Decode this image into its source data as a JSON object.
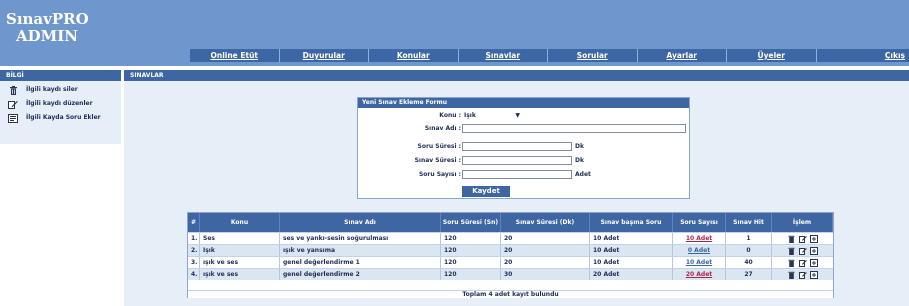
{
  "app": {
    "title_line1": "SınavPRO",
    "title_line2": "ADMIN"
  },
  "nav": [
    {
      "label": "Online Etüt"
    },
    {
      "label": "Duyurular"
    },
    {
      "label": "Konular"
    },
    {
      "label": "Sınavlar"
    },
    {
      "label": "Sorular"
    },
    {
      "label": "Ayarlar"
    },
    {
      "label": "Üyeler"
    },
    {
      "label": "Çıkış"
    }
  ],
  "sidebar": {
    "title": "BİLGİ",
    "items": [
      {
        "label": "İlgili kaydı siler",
        "icon": "trash-icon"
      },
      {
        "label": "İlgili kaydı düzenler",
        "icon": "edit-icon"
      },
      {
        "label": "İlgili Kayda Soru Ekler",
        "icon": "add-question-icon"
      }
    ]
  },
  "main": {
    "title": "SINAVLAR"
  },
  "form": {
    "title": "Yeni Sınav Ekleme Formu",
    "konu_label": "Konu :",
    "konu_value": "Işık",
    "sinav_adi_label": "Sınav Adı :",
    "sinav_adi_value": "",
    "soru_suresi_label": "Soru Süresi :",
    "soru_suresi_unit": "Dk",
    "sinav_suresi_label": "Sınav Süresi :",
    "sinav_suresi_unit": "Dk",
    "soru_sayisi_label": "Soru Sayısı :",
    "soru_sayisi_unit": "Adet",
    "submit_label": "Kaydet"
  },
  "table": {
    "headers": [
      "#",
      "Konu",
      "Sınav Adı",
      "Soru Süresi (Sn)",
      "Sınav Süresi (Dk)",
      "Sınav başına Soru",
      "Soru Sayısı",
      "Sınav Hit",
      "İşlem"
    ],
    "rows": [
      {
        "no": "1.",
        "konu": "Ses",
        "sinav_adi": "ses ve yankı-sesin soğurulması",
        "soru_suresi": "120",
        "sinav_suresi": "20",
        "soru_basina": "10 Adet",
        "soru_sayisi": "10 Adet",
        "hit": "1"
      },
      {
        "no": "2.",
        "konu": "Işık",
        "sinav_adi": "ışık ve yansıma",
        "soru_suresi": "120",
        "sinav_suresi": "20",
        "soru_basina": "10 Adet",
        "soru_sayisi": "0 Adet",
        "hit": "0"
      },
      {
        "no": "3.",
        "konu": "ışık ve ses",
        "sinav_adi": "genel değerlendirme 1",
        "soru_suresi": "120",
        "sinav_suresi": "20",
        "soru_basina": "10 Adet",
        "soru_sayisi": "10 Adet",
        "hit": "40"
      },
      {
        "no": "4.",
        "konu": "ışık ve ses",
        "sinav_adi": "genel değerlendirme 2",
        "soru_suresi": "120",
        "sinav_suresi": "30",
        "soru_basina": "20 Adet",
        "soru_sayisi": "20 Adet",
        "hit": "27"
      }
    ],
    "footer": "Toplam 4 adet kayıt bulundu"
  },
  "colors": {
    "header_bg": "#6f97cd",
    "bar_bg": "#3e66a3",
    "panel_bg": "#e6eef7",
    "link_red": "#a8264c",
    "link_blue": "#3b63a8"
  }
}
